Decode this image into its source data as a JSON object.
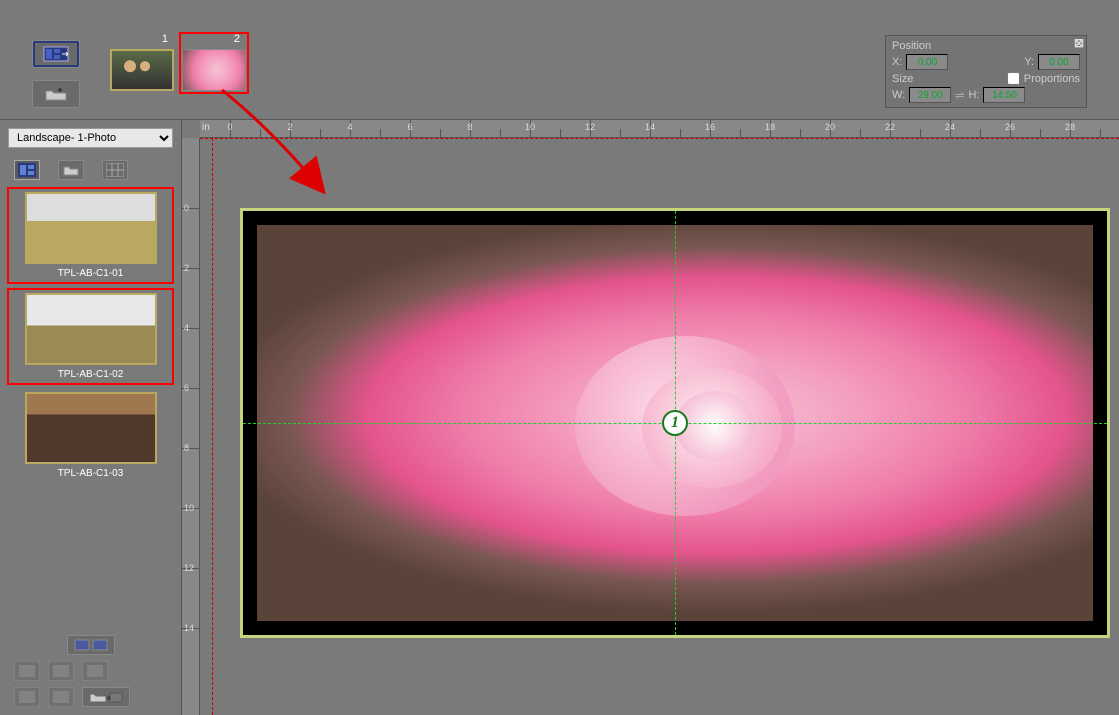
{
  "toolbar": {
    "tool_layout_name": "layout-tool",
    "tool_folder_name": "folder-tool"
  },
  "pages": {
    "items": [
      {
        "number": "1"
      },
      {
        "number": "2"
      }
    ]
  },
  "properties": {
    "position_label": "Position",
    "x_label": "X:",
    "x_value": "0.00",
    "y_label": "Y:",
    "y_value": "0.00",
    "size_label": "Size",
    "proportions_label": "Proportions",
    "w_label": "W:",
    "w_value": "29.00",
    "h_label": "H:",
    "h_value": "14.50"
  },
  "sidebar": {
    "dropdown_value": "Landscape- 1-Photo",
    "templates": [
      {
        "label": "TPL-AB-C1-01"
      },
      {
        "label": "TPL-AB-C1-02"
      },
      {
        "label": "TPL-AB-C1-03"
      }
    ]
  },
  "ruler": {
    "unit": "in",
    "h_ticks": [
      "0",
      "2",
      "4",
      "6",
      "8",
      "10",
      "12",
      "14",
      "16",
      "18",
      "20",
      "22",
      "24",
      "26",
      "28"
    ],
    "v_ticks": [
      "0",
      "2",
      "4",
      "6",
      "8",
      "10",
      "12",
      "14"
    ]
  },
  "canvas": {
    "center_badge": "1"
  }
}
